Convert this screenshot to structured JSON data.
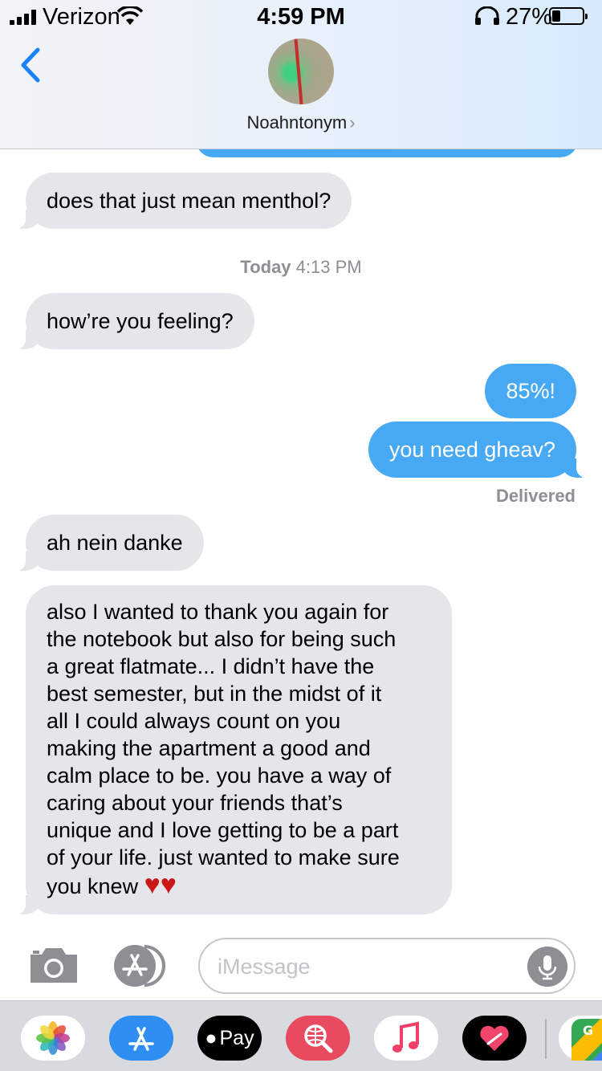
{
  "status_bar": {
    "carrier": "Verizon",
    "time": "4:59 PM",
    "battery_percent": "27%",
    "battery_level": 0.27
  },
  "header": {
    "contact_name": "Noahntonym",
    "chevron": "›",
    "back_icon": "chevron-left-icon"
  },
  "conversation": {
    "timestamp_day": "Today",
    "timestamp_time": "4:13 PM",
    "delivered_label": "Delivered",
    "messages": [
      {
        "direction": "incoming",
        "text": "does that just mean menthol?"
      },
      {
        "direction": "incoming",
        "text": "how’re you feeling?"
      },
      {
        "direction": "outgoing",
        "text": "85%!"
      },
      {
        "direction": "outgoing",
        "text": "you need gheav?"
      },
      {
        "direction": "incoming",
        "text": "ah nein danke"
      },
      {
        "direction": "incoming",
        "text": "also I wanted to thank you again for\nthe notebook but also for being such\na great flatmate... I didn’t have the\nbest semester, but in the midst of it\nall I could always count on you\nmaking the apartment a good and\ncalm place to be. you have a way of\ncaring about your friends that’s\nunique and I love getting to be a part\nof your life. just wanted to make sure\nyou knew",
        "emoji": "♥♥"
      }
    ]
  },
  "composer": {
    "placeholder": "iMessage",
    "value": ""
  },
  "app_drawer": {
    "apps": [
      "photos-icon",
      "app-store-icon",
      "apple-pay-icon",
      "web-search-icon",
      "music-icon",
      "digital-touch-icon",
      "google-maps-icon"
    ],
    "pay_label": "Pay"
  },
  "colors": {
    "outgoing_bubble": "#47a9f4",
    "incoming_bubble": "#e5e5ea",
    "accent": "#1a82fb"
  }
}
